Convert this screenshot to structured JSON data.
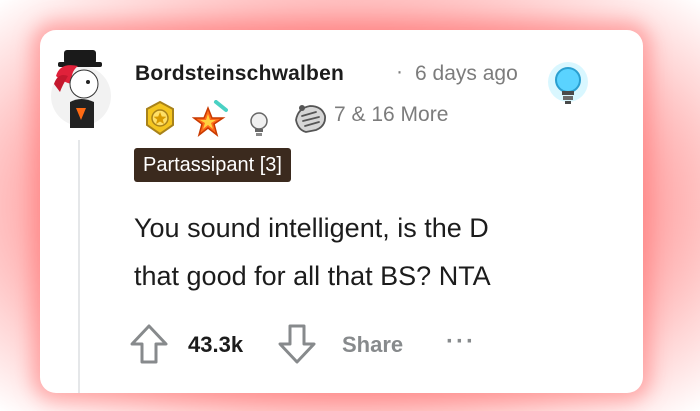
{
  "comment": {
    "username": "Bordsteinschwalben",
    "separator": "·",
    "time": "6 days ago",
    "awards_count_text": "7 & 16 More",
    "flair": "Partassipant [3]",
    "body_line1": "You sound intelligent, is the D",
    "body_line2": "that good for all that BS? NTA",
    "score": "43.3k",
    "share_label": "Share",
    "more_label": "···"
  },
  "icons": {
    "avatar": "avatar-icon",
    "bulb_award": "lightbulb-award-icon",
    "award1": "gold-award-icon",
    "award2": "starstruck-award-icon",
    "award3": "lightbulb-small-award-icon",
    "award4": "helpful-hand-award-icon",
    "upvote": "upvote-arrow-icon",
    "downvote": "downvote-arrow-icon"
  },
  "colors": {
    "glow": "#ff9a9a",
    "flair_bg": "#3b2a1e",
    "text": "#1c1c1c",
    "muted": "#7c7c7c"
  }
}
